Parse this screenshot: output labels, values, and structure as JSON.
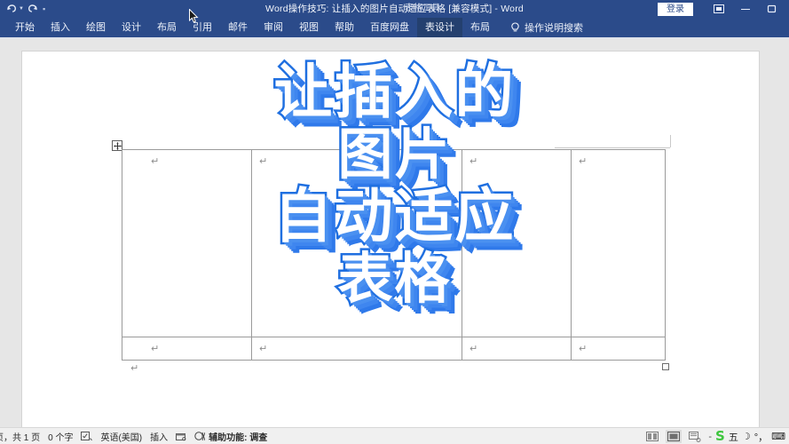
{
  "window": {
    "title": "Word操作技巧: 让插入的图片自动适应表格 [兼容模式]  -  Word",
    "contextual_tool_label": "表格工具",
    "signin_label": "登录",
    "quick_access": [
      {
        "name": "undo",
        "label": "撤消"
      },
      {
        "name": "redo",
        "label": "恢复"
      },
      {
        "name": "customize",
        "label": "自定义快速访问工具栏"
      }
    ],
    "controls": [
      {
        "name": "ribbon-display-options",
        "label": "功能区显示选项"
      },
      {
        "name": "minimize",
        "label": "最小化"
      },
      {
        "name": "restore",
        "label": "向下还原"
      }
    ]
  },
  "ribbon": {
    "tabs": [
      {
        "label": "开始",
        "active": false
      },
      {
        "label": "插入",
        "active": false
      },
      {
        "label": "绘图",
        "active": false
      },
      {
        "label": "设计",
        "active": false
      },
      {
        "label": "布局",
        "active": false
      },
      {
        "label": "引用",
        "active": false
      },
      {
        "label": "邮件",
        "active": false
      },
      {
        "label": "审阅",
        "active": false
      },
      {
        "label": "视图",
        "active": false
      },
      {
        "label": "帮助",
        "active": false
      },
      {
        "label": "百度网盘",
        "active": false
      },
      {
        "label": "表设计",
        "active": true
      },
      {
        "label": "布局",
        "active": false
      }
    ],
    "tell_me": {
      "icon": "lightbulb-icon",
      "label": "操作说明搜索"
    }
  },
  "document": {
    "table": {
      "rows": 2,
      "columns": 4,
      "cell_marks": [
        "↵",
        "↵",
        "↵",
        "↵",
        "↵",
        "↵",
        "↵",
        "↵"
      ],
      "paragraph_mark_below": "↵",
      "move_handle": "table-move-handle",
      "resize_handle": "table-resize-handle"
    }
  },
  "overlay": {
    "lines": [
      "让插入的",
      "图片",
      "自动适应",
      "表格"
    ],
    "fill_color": "#ffffff",
    "outline_color": "#1f6fe0",
    "shadow_color": "#4a90f0"
  },
  "status_bar": {
    "page_info": "页，共 1 页",
    "word_count": "0 个字",
    "proofing_icon": "spelling-check-icon",
    "language": "英语(美国)",
    "insert_mode": "插入",
    "macro_icon": "macro-record-icon",
    "accessibility": "辅助功能: 调查",
    "views": [
      {
        "name": "read-mode-view",
        "selected": false
      },
      {
        "name": "print-layout-view",
        "selected": true
      },
      {
        "name": "web-layout-view",
        "selected": false
      }
    ],
    "ime": {
      "dash": "-",
      "logo": "S",
      "mode": "五",
      "moon": "☽",
      "punct": "°，",
      "keyboard": "⌨"
    }
  },
  "colors": {
    "titlebar": "#2b4b8a",
    "ribbon_active_tab": "#24406f",
    "page_background": "#e6e6e6",
    "status_bar": "#f0f0f0"
  }
}
